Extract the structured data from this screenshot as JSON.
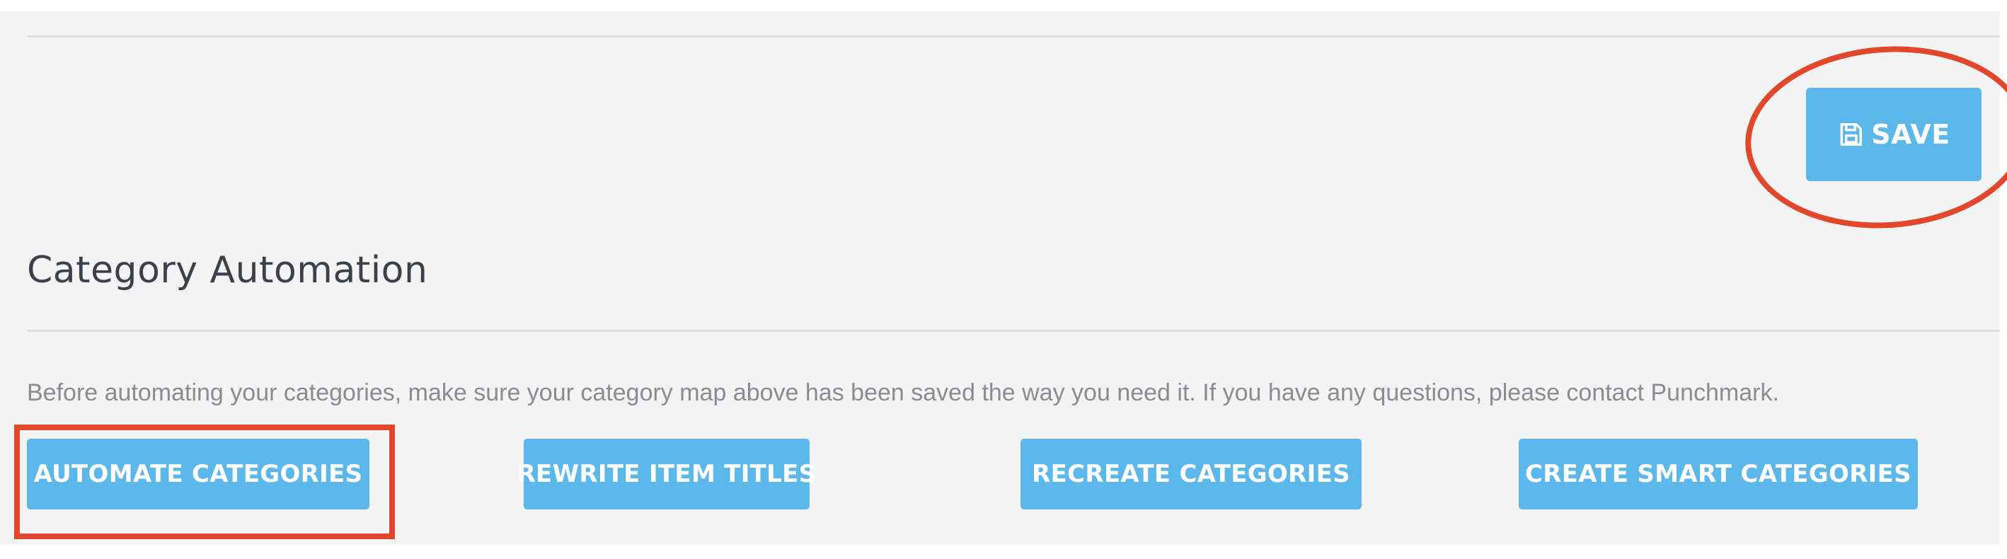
{
  "header": {
    "save_label": "SAVE",
    "save_icon": "floppy-disk-icon"
  },
  "category_automation": {
    "title": "Category Automation",
    "help_text": "Before automating your categories, make sure your category map above has been saved the way you need it. If you have any questions, please contact Punchmark.",
    "buttons": [
      {
        "label": "AUTOMATE CATEGORIES"
      },
      {
        "label": "REWRITE ITEM TITLES"
      },
      {
        "label": "RECREATE CATEGORIES"
      },
      {
        "label": "CREATE SMART CATEGORIES"
      }
    ]
  },
  "colors": {
    "button_bg": "#5cb8ea",
    "annotation_red": "#e2472b",
    "panel_bg": "#f4f4f4",
    "title_text": "#3d3f4a",
    "help_text": "#8a8b93"
  }
}
